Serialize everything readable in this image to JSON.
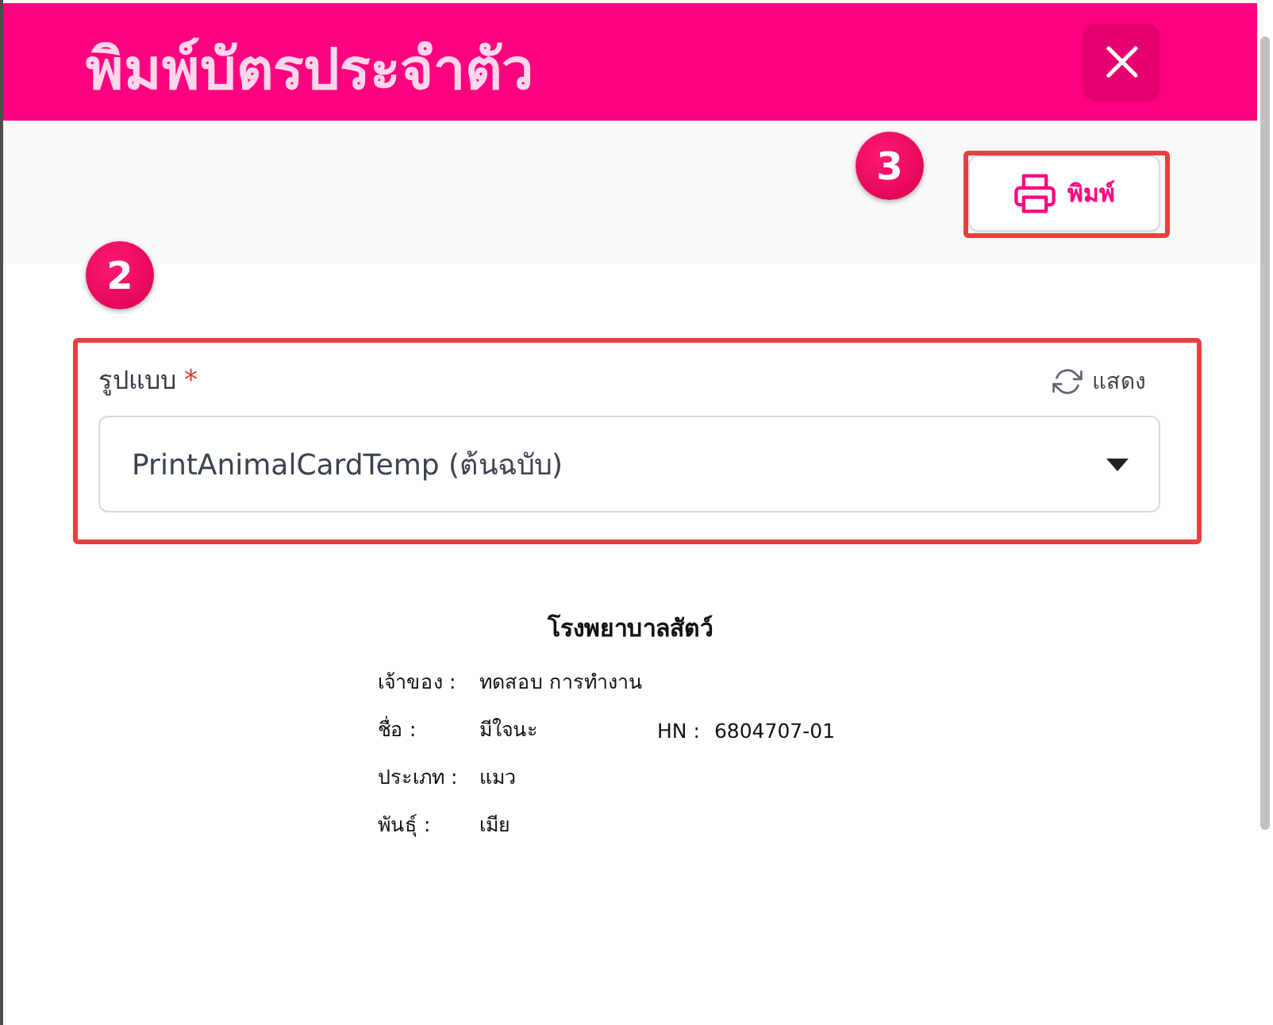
{
  "dialog": {
    "title": "พิมพ์บัตรประจำตัว"
  },
  "toolbar": {
    "print_button": {
      "label": "พิมพ์",
      "highlighted": true,
      "callout": "3"
    }
  },
  "template_field": {
    "label": "รูปแบบ",
    "required_mark": "*",
    "refresh_label": "แสดง",
    "value": "PrintAnimalCardTemp (ต้นฉบับ)",
    "highlighted": true,
    "callout": "2"
  },
  "card_preview": {
    "title": "โรงพยาบาลสัตว์",
    "rows": [
      {
        "fields": [
          {
            "label": "เจ้าของ :",
            "value": "ทดสอบ การทำงาน"
          }
        ]
      },
      {
        "fields": [
          {
            "label": "ชื่อ :",
            "value": "มีใจนะ"
          },
          {
            "label": "HN :",
            "value": "6804707-01"
          }
        ]
      },
      {
        "fields": [
          {
            "label": "ประเภท :",
            "value": "แมว"
          }
        ]
      },
      {
        "fields": [
          {
            "label": "พันธุ์ :",
            "value": "เมีย"
          }
        ]
      }
    ]
  }
}
